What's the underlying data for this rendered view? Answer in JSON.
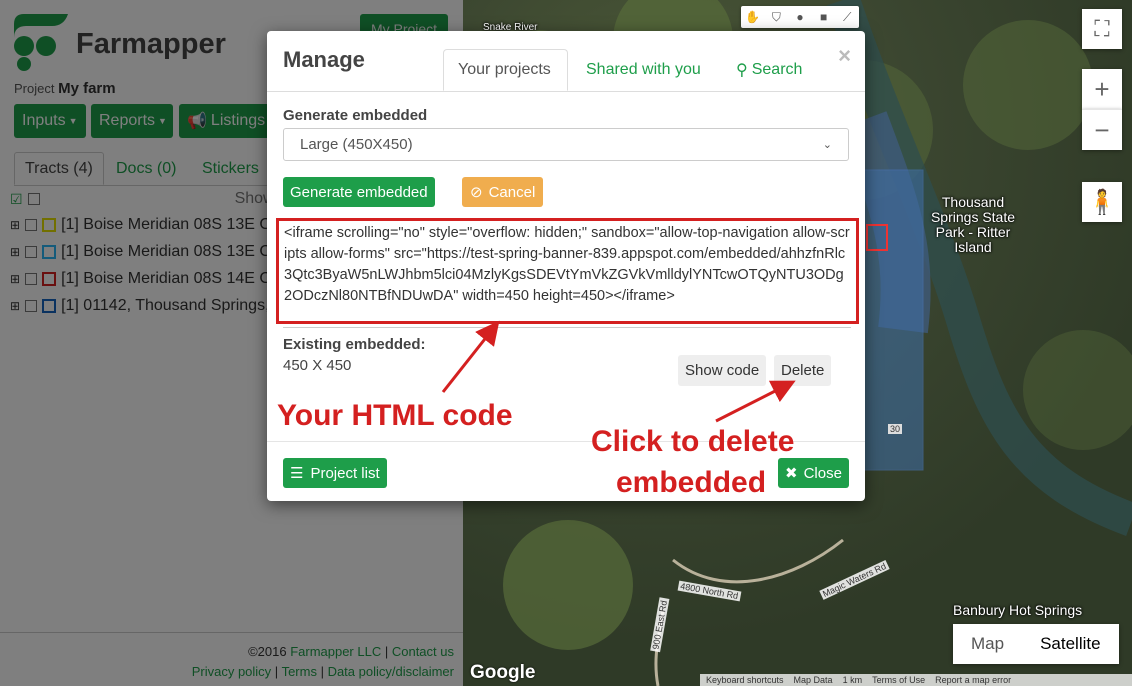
{
  "sidebar": {
    "brand": "Farmapper",
    "project_prefix": "Project",
    "project_name": "My farm",
    "top_button": "My Project",
    "buttons": {
      "inputs": "Inputs",
      "reports": "Reports",
      "listings": "Listings"
    },
    "tabs": [
      {
        "label": "Tracts (4)"
      },
      {
        "label": "Docs  (0)"
      },
      {
        "label": "Stickers"
      }
    ],
    "show_label": "Show",
    "tracts": [
      {
        "label": "[1] Boise Meridian 08S 13E C",
        "color": "#e5e000"
      },
      {
        "label": "[1] Boise Meridian 08S 13E C",
        "color": "#29b6f6"
      },
      {
        "label": "[1] Boise Meridian 08S 14E C",
        "color": "#d42020"
      },
      {
        "label": "[1] 01142, Thousand Springs,",
        "color": "#1565c0"
      }
    ],
    "footer": {
      "copyright": "©2016",
      "company": "Farmapper LLC",
      "contact": "Contact us",
      "privacy": "Privacy policy",
      "terms": "Terms",
      "data_policy": "Data policy/disclaimer"
    }
  },
  "map": {
    "labels": {
      "thousand_springs": "Thousand Springs State Park - Ritter Island",
      "banbury": "Banbury Hot Springs",
      "snake_river": "Snake River",
      "road1": "4800 North Rd",
      "road2": "Magic Waters Rd",
      "road3": "900 East Rd",
      "highway": "30"
    },
    "maptype": {
      "map": "Map",
      "satellite": "Satellite"
    },
    "google": "Google",
    "attribution": [
      "Keyboard shortcuts",
      "Map Data",
      "1 km",
      "Terms of Use",
      "Report a map error"
    ],
    "zoom_in": "+",
    "zoom_out": "−"
  },
  "modal": {
    "title": "Manage",
    "close": "×",
    "tabs": {
      "your_projects": "Your projects",
      "shared": "Shared with you",
      "search": "Search"
    },
    "generate_label": "Generate embedded",
    "select_value": "Large (450X450)",
    "generate_button": "Generate embedded",
    "cancel_button": "Cancel",
    "code": "<iframe scrolling=\"no\" style=\"overflow: hidden;\" sandbox=\"allow-top-navigation allow-scripts allow-forms\" src=\"https://test-spring-banner-839.appspot.com/embedded/ahhzfnRlc3Qtc3ByaW5nLWJhbm5lci04MzlyKgsSDEVtYmVkZGVkVmlldylYNTcwOTQyNTU3ODg2ODczNl80NTBfNDUwDA\" width=450 height=450></iframe>",
    "existing_label": "Existing embedded:",
    "existing_size": "450 X 450",
    "show_code": "Show code",
    "delete": "Delete",
    "project_list": "Project list",
    "close_button": "Close"
  },
  "annotations": {
    "html_code": "Your HTML code",
    "delete_line1": "Click to delete",
    "delete_line2": "embedded"
  }
}
